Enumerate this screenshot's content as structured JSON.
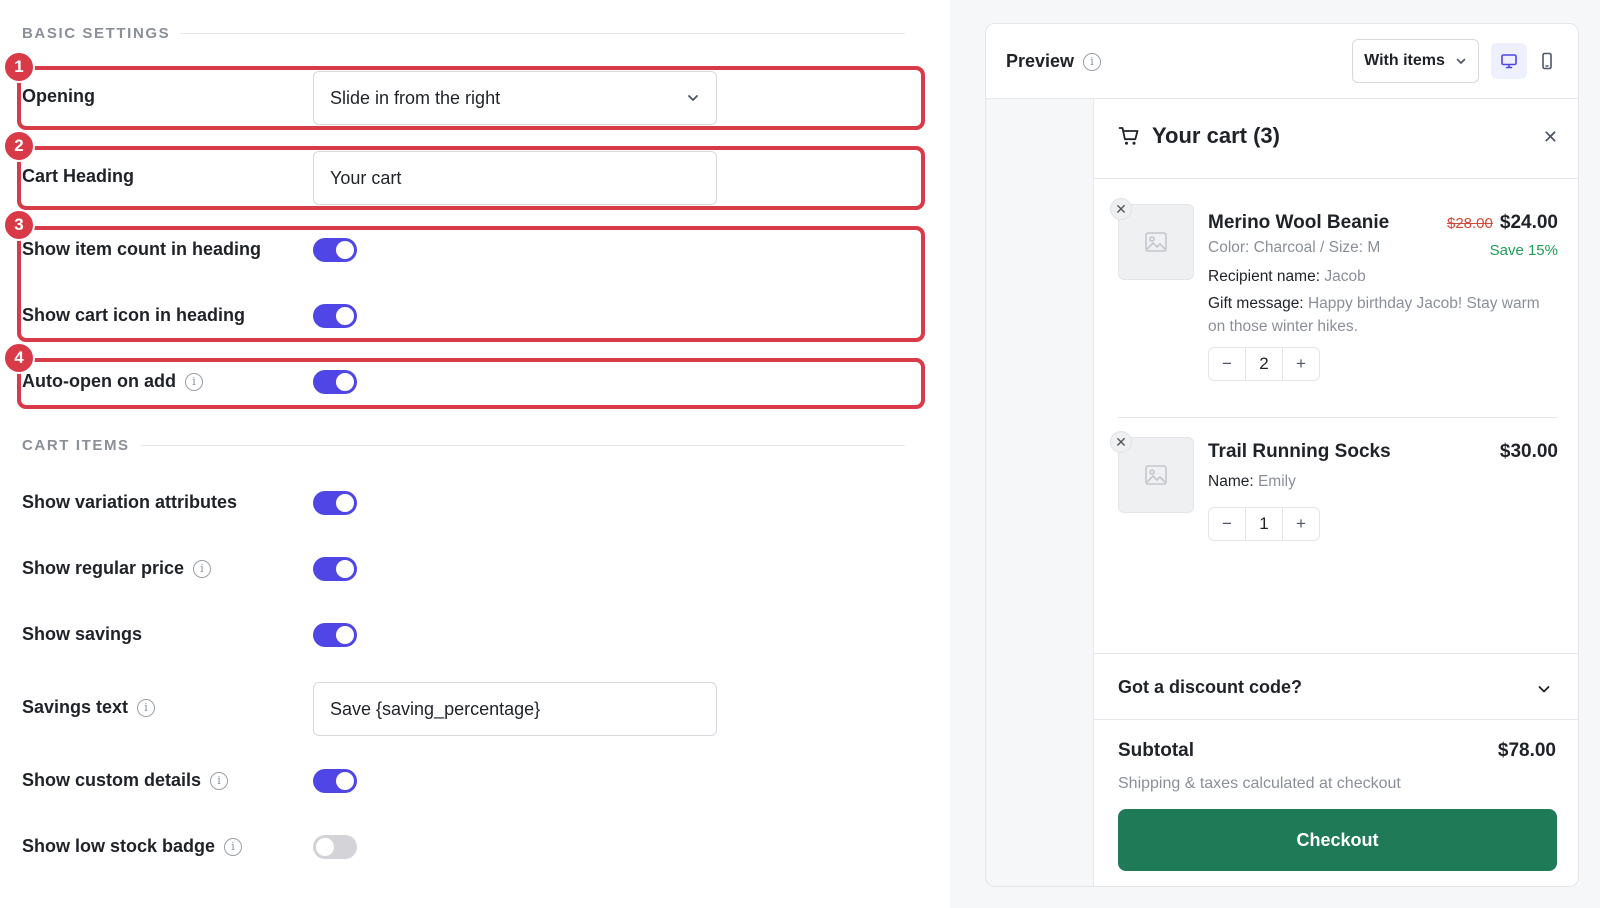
{
  "colors": {
    "accent": "#4f46e5",
    "highlight": "#d93a48",
    "checkout": "#1e7a57",
    "savings": "#1f9d55",
    "old_price": "#d1493a"
  },
  "basic_settings": {
    "heading": "BASIC SETTINGS",
    "opening": {
      "label": "Opening",
      "value": "Slide in from the right"
    },
    "cart_heading": {
      "label": "Cart Heading",
      "value": "Your cart"
    },
    "show_item_count": {
      "label": "Show item count in heading",
      "enabled": true
    },
    "show_cart_icon": {
      "label": "Show cart icon in heading",
      "enabled": true
    },
    "auto_open": {
      "label": "Auto-open on add",
      "enabled": true
    }
  },
  "cart_items": {
    "heading": "CART ITEMS",
    "show_variation": {
      "label": "Show variation attributes",
      "enabled": true
    },
    "show_regular_price": {
      "label": "Show regular price",
      "enabled": true
    },
    "show_savings": {
      "label": "Show savings",
      "enabled": true
    },
    "savings_text": {
      "label": "Savings text",
      "value": "Save {saving_percentage}"
    },
    "show_custom_details": {
      "label": "Show custom details",
      "enabled": true
    },
    "show_low_stock": {
      "label": "Show low stock badge",
      "enabled": false
    }
  },
  "annotations": [
    "1",
    "2",
    "3",
    "4"
  ],
  "preview": {
    "title": "Preview",
    "mode": "With items",
    "cart": {
      "title": "Your cart (3)",
      "items": [
        {
          "name": "Merino Wool Beanie",
          "old_price": "$28.00",
          "price": "$24.00",
          "save": "Save 15%",
          "variant": "Color: Charcoal / Size: M",
          "recipient_label": "Recipient name:",
          "recipient_value": "Jacob",
          "gift_label": "Gift message:",
          "gift_value": "Happy birthday Jacob! Stay warm on those winter hikes.",
          "qty": "2"
        },
        {
          "name": "Trail Running Socks",
          "price": "$30.00",
          "name_label": "Name:",
          "name_value": "Emily",
          "qty": "1"
        }
      ],
      "discount": "Got a discount code?",
      "subtotal_label": "Subtotal",
      "subtotal_value": "$78.00",
      "shipping_note": "Shipping & taxes calculated at checkout",
      "checkout": "Checkout"
    }
  }
}
